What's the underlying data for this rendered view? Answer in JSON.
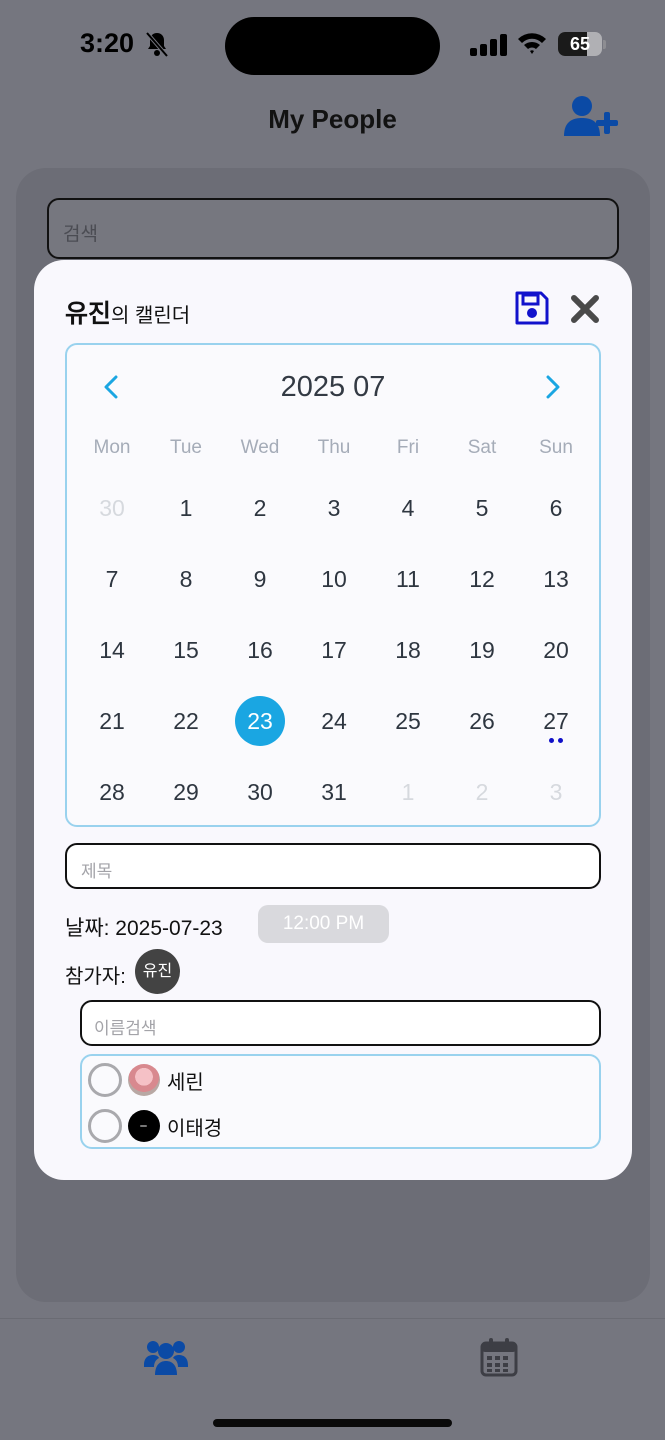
{
  "status_bar": {
    "time": "3:20",
    "battery": "65",
    "battery_level": 0.65
  },
  "header": {
    "title": "My People"
  },
  "background": {
    "search_placeholder": "검색"
  },
  "modal": {
    "title_name": "유진",
    "title_suffix": "의 캘린더",
    "calendar": {
      "month_label": "2025 07",
      "weekdays": [
        "Mon",
        "Tue",
        "Wed",
        "Thu",
        "Fri",
        "Sat",
        "Sun"
      ],
      "days": [
        {
          "d": "30",
          "muted": true
        },
        {
          "d": "1"
        },
        {
          "d": "2"
        },
        {
          "d": "3"
        },
        {
          "d": "4"
        },
        {
          "d": "5"
        },
        {
          "d": "6"
        },
        {
          "d": "7"
        },
        {
          "d": "8"
        },
        {
          "d": "9"
        },
        {
          "d": "10"
        },
        {
          "d": "11"
        },
        {
          "d": "12"
        },
        {
          "d": "13"
        },
        {
          "d": "14"
        },
        {
          "d": "15"
        },
        {
          "d": "16"
        },
        {
          "d": "17"
        },
        {
          "d": "18"
        },
        {
          "d": "19"
        },
        {
          "d": "20"
        },
        {
          "d": "21"
        },
        {
          "d": "22"
        },
        {
          "d": "23",
          "selected": true
        },
        {
          "d": "24"
        },
        {
          "d": "25"
        },
        {
          "d": "26"
        },
        {
          "d": "27",
          "events": 2
        },
        {
          "d": "28"
        },
        {
          "d": "29"
        },
        {
          "d": "30"
        },
        {
          "d": "31"
        },
        {
          "d": "1",
          "muted": true
        },
        {
          "d": "2",
          "muted": true
        },
        {
          "d": "3",
          "muted": true
        }
      ]
    },
    "title_placeholder": "제목",
    "date_label": "날짜: 2025-07-23",
    "time_value": "12:00 PM",
    "participants_label": "참가자:",
    "participant_chip": "유진",
    "name_search_placeholder": "이름검색",
    "people": [
      {
        "name": "세린",
        "avatar": "photo"
      },
      {
        "name": "이태경",
        "avatar": "black"
      }
    ]
  },
  "tabs": [
    {
      "icon": "users-icon",
      "active": true
    },
    {
      "icon": "calendar-icon",
      "active": false
    }
  ],
  "colors": {
    "accent": "#1aa6e2",
    "brand_blue": "#0b4aa5",
    "save_blue": "#1212cc"
  }
}
